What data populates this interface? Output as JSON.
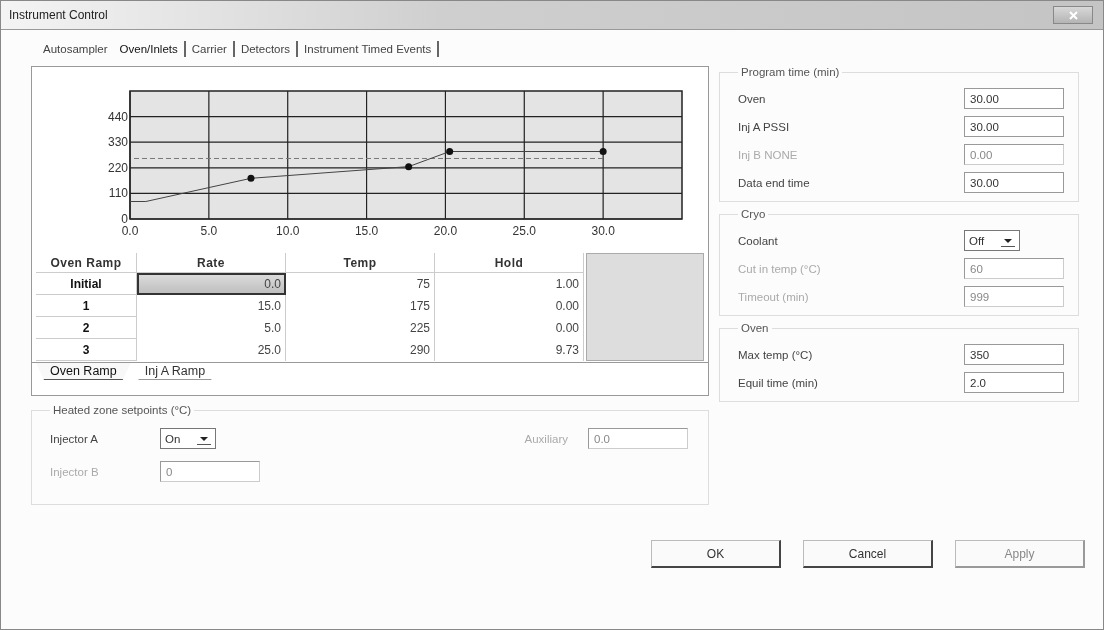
{
  "window": {
    "title": "Instrument Control"
  },
  "tabs": [
    {
      "label": "Autosampler",
      "selected": false
    },
    {
      "label": "Oven/Inlets",
      "selected": true
    },
    {
      "label": "Carrier",
      "selected": false
    },
    {
      "label": "Detectors",
      "selected": false
    },
    {
      "label": "Instrument Timed Events",
      "selected": false
    }
  ],
  "chart_data": {
    "type": "line",
    "x": [
      0,
      1,
      7.67,
      17.67,
      20.27,
      30
    ],
    "grid": true,
    "ref_lines": [
      {
        "axis": "y",
        "value": 260
      }
    ],
    "series": [
      {
        "color": "#444444",
        "values": [
          75,
          75,
          175,
          225,
          290,
          290
        ]
      }
    ],
    "xlim": [
      0,
      35
    ],
    "ylim": [
      0,
      550
    ],
    "xticks": [
      {
        "value": 0,
        "label": "0.0"
      },
      {
        "value": 5,
        "label": "5.0"
      },
      {
        "value": 10,
        "label": "10.0"
      },
      {
        "value": 15,
        "label": "15.0"
      },
      {
        "value": 20,
        "label": "20.0"
      },
      {
        "value": 25,
        "label": "25.0"
      },
      {
        "value": 30,
        "label": "30.0"
      }
    ],
    "yticks": [
      0,
      110,
      220,
      330,
      440
    ]
  },
  "ramp_table": {
    "columns": [
      "Oven Ramp",
      "Rate",
      "Temp",
      "Hold"
    ],
    "rows": [
      {
        "label": "Initial",
        "rate": "0.0",
        "temp": "75",
        "hold": "1.00",
        "selected": true
      },
      {
        "label": "1",
        "rate": "15.0",
        "temp": "175",
        "hold": "0.00",
        "selected": false
      },
      {
        "label": "2",
        "rate": "5.0",
        "temp": "225",
        "hold": "0.00",
        "selected": false
      },
      {
        "label": "3",
        "rate": "25.0",
        "temp": "290",
        "hold": "9.73",
        "selected": false
      }
    ]
  },
  "ramp_tabs": [
    {
      "label": "Oven Ramp",
      "selected": true
    },
    {
      "label": "Inj A Ramp",
      "selected": false
    }
  ],
  "heated_zone": {
    "title": "Heated zone setpoints (°C)",
    "fields": [
      {
        "label": "Injector A",
        "value": "On",
        "kind": "dropdown",
        "disabled": false
      },
      {
        "label": "Auxiliary",
        "value": "0.0",
        "kind": "text",
        "disabled": true
      },
      {
        "label": "Injector B",
        "value": "0",
        "kind": "text",
        "disabled": true
      }
    ]
  },
  "program_time": {
    "title": "Program time (min)",
    "fields": [
      {
        "label": "Oven",
        "value": "30.00",
        "kind": "text",
        "disabled": false
      },
      {
        "label": "Inj A  PSSI",
        "value": "30.00",
        "kind": "text",
        "disabled": false
      },
      {
        "label": "Inj B  NONE",
        "value": "0.00",
        "kind": "text",
        "disabled": true
      },
      {
        "label": "Data end time",
        "value": "30.00",
        "kind": "text",
        "disabled": false
      }
    ]
  },
  "cryo": {
    "title": "Cryo",
    "fields": [
      {
        "label": "Coolant",
        "value": "Off",
        "kind": "dropdown",
        "disabled": false
      },
      {
        "label": "Cut in temp (°C)",
        "value": "60",
        "kind": "text",
        "disabled": true
      },
      {
        "label": "Timeout  (min)",
        "value": "999",
        "kind": "text",
        "disabled": true
      }
    ]
  },
  "oven": {
    "title": "Oven",
    "fields": [
      {
        "label": "Max temp (°C)",
        "value": "350",
        "kind": "text",
        "disabled": false
      },
      {
        "label": "Equil time (min)",
        "value": "2.0",
        "kind": "text",
        "disabled": false
      }
    ]
  },
  "buttons": [
    {
      "label": "OK",
      "disabled": false
    },
    {
      "label": "Cancel",
      "disabled": false
    },
    {
      "label": "Apply",
      "disabled": true
    }
  ]
}
